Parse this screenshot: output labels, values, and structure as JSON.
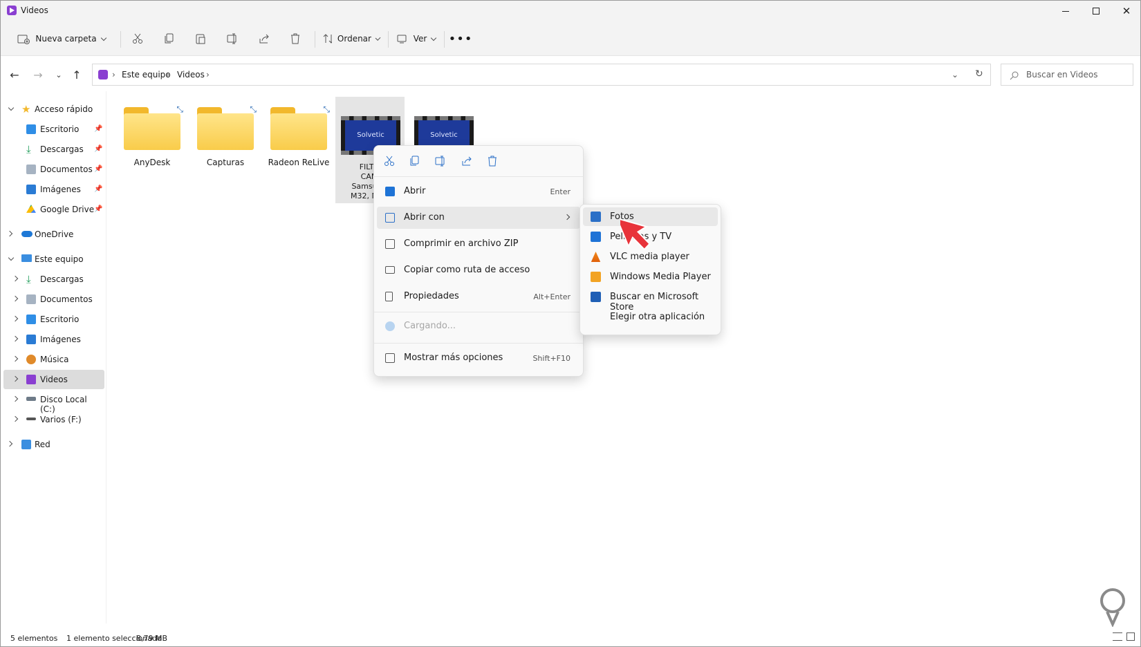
{
  "window": {
    "title": "Videos"
  },
  "toolbar": {
    "new_folder": "Nueva carpeta",
    "sort": "Ordenar",
    "view": "Ver"
  },
  "address": {
    "crumbs": [
      "Este equipo",
      "Videos"
    ]
  },
  "search": {
    "placeholder": "Buscar en Videos"
  },
  "sidebar": {
    "quick_access": "Acceso rápido",
    "quick_items": [
      "Escritorio",
      "Descargas",
      "Documentos",
      "Imágenes",
      "Google Drive"
    ],
    "onedrive": "OneDrive",
    "this_pc": "Este equipo",
    "pc_items": [
      "Descargas",
      "Documentos",
      "Escritorio",
      "Imágenes",
      "Música",
      "Videos",
      "Disco Local (C:)",
      "Varios (F:)"
    ],
    "network": "Red"
  },
  "files": {
    "folders": [
      "AnyDesk",
      "Capturas",
      "Radeon ReLive"
    ],
    "video1_name_lines": [
      "FILTR",
      "CAM",
      "Samsung",
      "M32, M42"
    ],
    "thumb_text": "Solvetic"
  },
  "context_menu": {
    "items": [
      {
        "label": "Abrir",
        "shortcut": "Enter"
      },
      {
        "label": "Abrir con",
        "shortcut": ""
      },
      {
        "label": "Comprimir en archivo ZIP",
        "shortcut": ""
      },
      {
        "label": "Copiar como ruta de acceso",
        "shortcut": ""
      },
      {
        "label": "Propiedades",
        "shortcut": "Alt+Enter"
      },
      {
        "label": "Cargando...",
        "shortcut": ""
      },
      {
        "label": "Mostrar más opciones",
        "shortcut": "Shift+F10"
      }
    ]
  },
  "submenu": {
    "items": [
      "Fotos",
      "Películas y TV",
      "VLC media player",
      "Windows Media Player",
      "Buscar en Microsoft Store",
      "Elegir otra aplicación"
    ]
  },
  "status": {
    "count": "5 elementos",
    "selection": "1 elemento seleccionado",
    "size": "8,79 MB"
  },
  "colors": {
    "accent": "#8a3fd1",
    "folder": "#f9cc4a",
    "cursor": "#e8333a"
  }
}
